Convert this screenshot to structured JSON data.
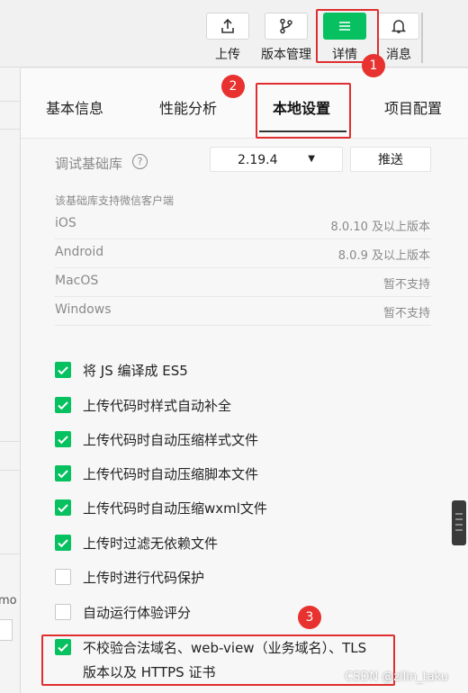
{
  "toolbar": {
    "upload": "上传",
    "version": "版本管理",
    "details": "详情",
    "messages": "消息"
  },
  "annotations": {
    "b1": "1",
    "b2": "2",
    "b3": "3"
  },
  "tabs": [
    "基本信息",
    "性能分析",
    "本地设置",
    "项目配置"
  ],
  "debug": {
    "label": "调试基础库",
    "help": "?",
    "version": "2.19.4",
    "caret": "▼",
    "push": "推送"
  },
  "clients": {
    "caption": "该基础库支持微信客户端",
    "rows": [
      {
        "os": "iOS",
        "req": "8.0.10 及以上版本"
      },
      {
        "os": "Android",
        "req": "8.0.9 及以上版本"
      },
      {
        "os": "MacOS",
        "req": "暂不支持"
      },
      {
        "os": "Windows",
        "req": "暂不支持"
      }
    ]
  },
  "options": [
    {
      "label": "将 JS 编译成 ES5",
      "checked": true
    },
    {
      "label": "上传代码时样式自动补全",
      "checked": true
    },
    {
      "label": "上传代码时自动压缩样式文件",
      "checked": true
    },
    {
      "label": "上传代码时自动压缩脚本文件",
      "checked": true
    },
    {
      "label": "上传代码时自动压缩wxml文件",
      "checked": true
    },
    {
      "label": "上传时过滤无依赖文件",
      "checked": true
    },
    {
      "label": "上传时进行代码保护",
      "checked": false
    },
    {
      "label": "自动运行体验评分",
      "checked": false
    },
    {
      "label": "不校验合法域名、web-view（业务域名）、TLS",
      "label2": "版本以及 HTTPS 证书",
      "checked": true
    }
  ],
  "left_fragment": "mo",
  "watermark": "CSDN @zilin_taku",
  "colors": {
    "accent": "#07c160",
    "highlight": "#e02e2e"
  }
}
